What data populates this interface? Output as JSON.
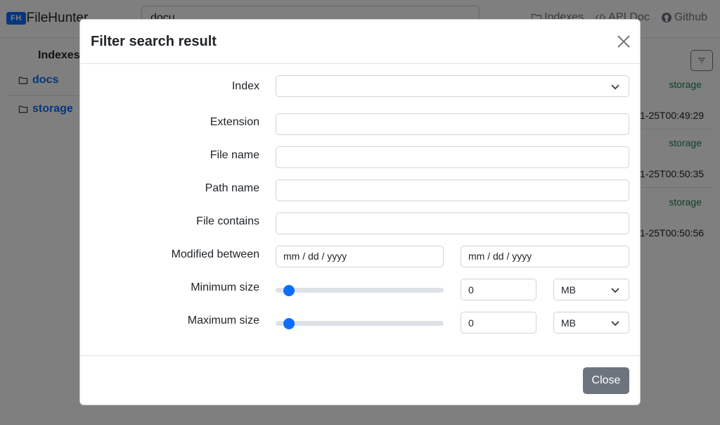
{
  "navbar": {
    "brand_badge": "FH",
    "brand_name": "FileHunter",
    "search_value": "docu",
    "links": [
      {
        "label": "Indexes",
        "icon": "folder-icon"
      },
      {
        "label": "API Doc",
        "icon": "code-icon"
      },
      {
        "label": "Github",
        "icon": "github-icon"
      }
    ]
  },
  "sidebar": {
    "title": "Indexes",
    "items": [
      {
        "label": "docs",
        "icon": "folder-icon"
      },
      {
        "label": "storage",
        "icon": "folder-icon"
      }
    ]
  },
  "results": {
    "tags": [
      "storage",
      "storage",
      "storage"
    ],
    "dates": [
      "1-25T00:49:29",
      "1-25T00:50:35",
      "1-25T00:50:56"
    ]
  },
  "modal": {
    "title": "Filter search result",
    "fields": {
      "index": {
        "label": "Index",
        "value": ""
      },
      "extension": {
        "label": "Extension",
        "value": ""
      },
      "file_name": {
        "label": "File name",
        "value": ""
      },
      "path_name": {
        "label": "Path name",
        "value": ""
      },
      "file_contains": {
        "label": "File contains",
        "value": ""
      },
      "modified": {
        "label": "Modified between",
        "from_placeholder": "mm / dd / yyyy",
        "to_placeholder": "mm / dd / yyyy"
      },
      "min_size": {
        "label": "Minimum size",
        "value": "0",
        "unit": "MB",
        "slider_level": 0
      },
      "max_size": {
        "label": "Maximum size",
        "value": "0",
        "unit": "MB",
        "slider_level": 0
      }
    },
    "close_label": "Close"
  },
  "colors": {
    "primary": "#0d6efd",
    "secondary": "#6c757d",
    "success": "#198754"
  }
}
